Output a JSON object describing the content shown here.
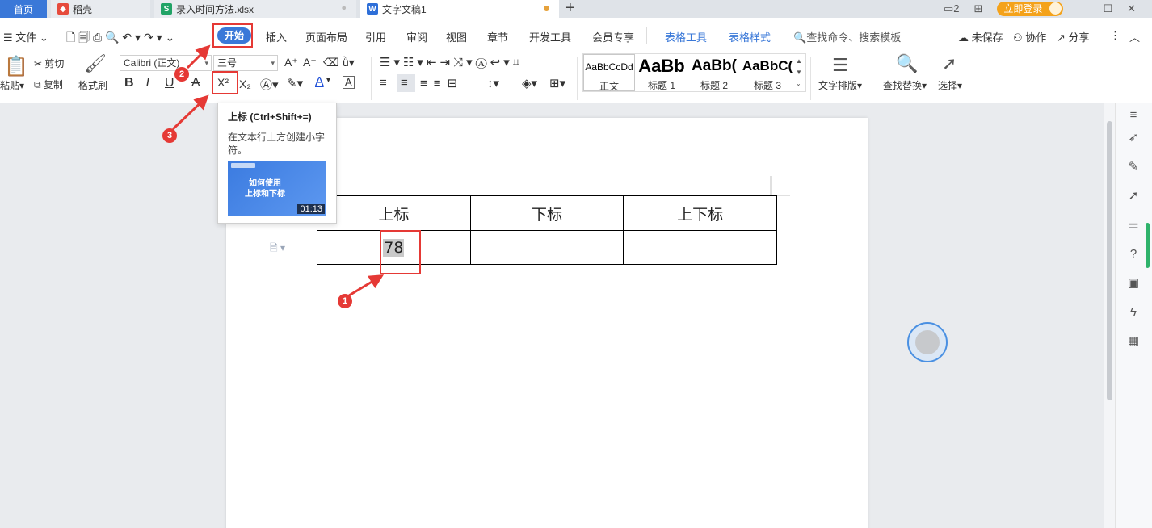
{
  "tabs": {
    "home": "首页",
    "daoke": "稻壳",
    "excel": "录入时间方法.xlsx",
    "doc": "文字文稿1",
    "new_tab": "+"
  },
  "window": {
    "login": "立即登录",
    "layout_num": "2"
  },
  "menu": {
    "file": "文件",
    "start": "开始",
    "insert": "插入",
    "page_layout": "页面布局",
    "reference": "引用",
    "review": "审阅",
    "view": "视图",
    "chapter": "章节",
    "developer": "开发工具",
    "member": "会员专享",
    "table_tools": "表格工具",
    "table_style": "表格样式",
    "search": "查找命令、搜索模板",
    "unsaved": "未保存",
    "collab": "协作",
    "share": "分享"
  },
  "ribbon": {
    "paste": "粘贴",
    "cut": "剪切",
    "copy": "复制",
    "format_painter": "格式刷",
    "font_name": "Calibri (正文)",
    "font_size": "三号",
    "bold": "B",
    "italic": "I",
    "underline": "U",
    "strike": "A",
    "superscript": "X²",
    "subscript": "X₂",
    "font_color": "A",
    "char_border": "A",
    "styles": [
      {
        "sample": "AaBbCcDd",
        "name": "正文"
      },
      {
        "sample": "AaBb",
        "name": "标题 1"
      },
      {
        "sample": "AaBb(",
        "name": "标题 2"
      },
      {
        "sample": "AaBbC(",
        "name": "标题 3"
      }
    ],
    "text_layout": "文字排版",
    "find_replace": "查找替换",
    "select": "选择"
  },
  "tooltip": {
    "title": "上标 (Ctrl+Shift+=)",
    "desc": "在文本行上方创建小字符。",
    "video_title_1": "如何使用",
    "video_title_2": "上标和下标",
    "duration": "01:13"
  },
  "table": {
    "headers": [
      "上标",
      "下标",
      "上下标"
    ],
    "cell_value": "78"
  },
  "annotations": {
    "one": "1",
    "two": "2",
    "three": "3"
  },
  "colors": {
    "accent": "#3a78d8",
    "highlight": "#e53935",
    "login": "#f4a21a"
  }
}
